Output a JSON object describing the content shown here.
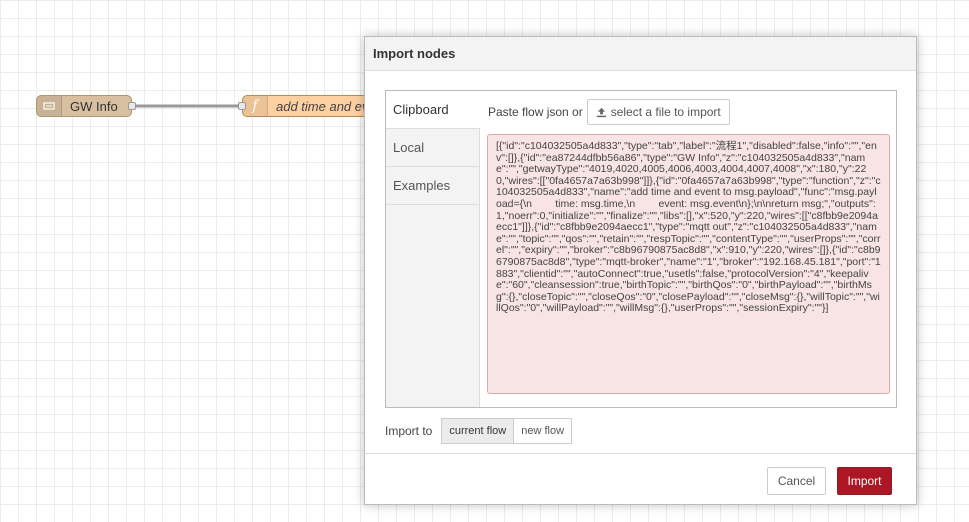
{
  "canvas": {
    "nodes": [
      {
        "label": "GW Info",
        "icon": "inject-icon"
      },
      {
        "label": "add time and event",
        "icon": "function-icon"
      }
    ]
  },
  "dialog": {
    "title": "Import nodes",
    "tabs": [
      {
        "label": "Clipboard",
        "active": true
      },
      {
        "label": "Local",
        "active": false
      },
      {
        "label": "Examples",
        "active": false
      }
    ],
    "paste_label": "Paste flow json or",
    "file_button_label": "select a file to import",
    "json_text": "[{\"id\":\"c104032505a4d833\",\"type\":\"tab\",\"label\":\"流程1\",\"disabled\":false,\"info\":\"\",\"env\":[]},{\"id\":\"ea87244dfbb56a86\",\"type\":\"GW Info\",\"z\":\"c104032505a4d833\",\"name\":\"\",\"getwayType\":\"4019,4020,4005,4006,4003,4004,4007,4008\",\"x\":180,\"y\":220,\"wires\":[[\"0fa4657a7a63b998\"]]},{\"id\":\"0fa4657a7a63b998\",\"type\":\"function\",\"z\":\"c104032505a4d833\",\"name\":\"add time and event to msg.payload\",\"func\":\"msg.payload={\\n        time: msg.time,\\n        event: msg.event\\n};\\n\\nreturn msg;\",\"outputs\":1,\"noerr\":0,\"initialize\":\"\",\"finalize\":\"\",\"libs\":[],\"x\":520,\"y\":220,\"wires\":[[\"c8fbb9e2094aecc1\"]]},{\"id\":\"c8fbb9e2094aecc1\",\"type\":\"mqtt out\",\"z\":\"c104032505a4d833\",\"name\":\"\",\"topic\":\"\",\"qos\":\"\",\"retain\":\"\",\"respTopic\":\"\",\"contentType\":\"\",\"userProps\":\"\",\"correl\":\"\",\"expiry\":\"\",\"broker\":\"c8b96790875ac8d8\",\"x\":910,\"y\":220,\"wires\":[]},{\"id\":\"c8b96790875ac8d8\",\"type\":\"mqtt-broker\",\"name\":\"1\",\"broker\":\"192.168.45.181\",\"port\":\"1883\",\"clientid\":\"\",\"autoConnect\":true,\"usetls\":false,\"protocolVersion\":\"4\",\"keepalive\":\"60\",\"cleansession\":true,\"birthTopic\":\"\",\"birthQos\":\"0\",\"birthPayload\":\"\",\"birthMsg\":{},\"closeTopic\":\"\",\"closeQos\":\"0\",\"closePayload\":\"\",\"closeMsg\":{},\"willTopic\":\"\",\"willQos\":\"0\",\"willPayload\":\"\",\"willMsg\":{},\"userProps\":\"\",\"sessionExpiry\":\"\"}]",
    "import_to_label": "Import to",
    "import_to_options": [
      {
        "label": "current flow",
        "selected": true
      },
      {
        "label": "new flow",
        "selected": false
      }
    ],
    "cancel_label": "Cancel",
    "import_label": "Import"
  },
  "colors": {
    "import_button": "#ad1625",
    "json_area_bg": "#f8e4e4",
    "node_inject": "#d8bfa0",
    "node_function": "#fdd0a2"
  }
}
